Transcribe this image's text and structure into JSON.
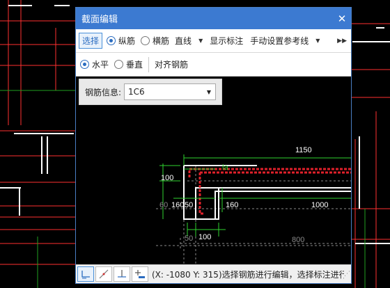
{
  "dialog": {
    "title": "截面编辑",
    "close_icon": "close-icon"
  },
  "toolbar": {
    "select_label": "选择",
    "radio_longitudinal": "纵筋",
    "radio_transverse": "横筋",
    "line_mode": "直线",
    "show_dimension": "显示标注",
    "manual_reference": "手动设置参考线",
    "more_icon": "double-chevron-right-icon"
  },
  "toolbar2": {
    "radio_horizontal": "水平",
    "radio_vertical": "垂直",
    "align_label": "对齐钢筋"
  },
  "info_panel": {
    "label": "钢筋信息:",
    "value": "1C6"
  },
  "drawing": {
    "dim_1150": "1150",
    "dim_la": "la",
    "dim_100_left": "100",
    "dim_60": "60",
    "dim_160_left": "160",
    "dim_50": "50",
    "dim_160_right": "160",
    "dim_1000": "1000",
    "dim_50_bottom": "50",
    "dim_100_bottom": "100",
    "dim_800": "800"
  },
  "statusbar": {
    "text": "(X: -1080 Y: 315)选择钢筋进行编辑，选择标注进行"
  },
  "colors": {
    "accent": "#3c7ad1",
    "rebar": "#e0202a",
    "dimension": "#2fd42f",
    "outline": "#ffffff"
  }
}
